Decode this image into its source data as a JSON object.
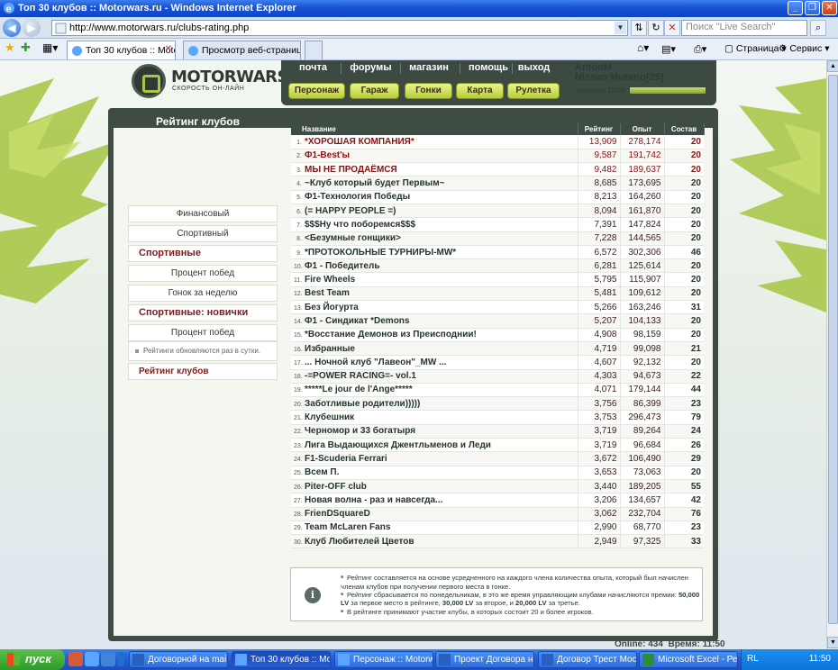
{
  "window": {
    "title": "Топ 30 клубов :: Motorwars.ru - Windows Internet Explorer"
  },
  "address_bar": {
    "url": "http://www.motorwars.ru/clubs-rating.php",
    "search_placeholder": "Поиск \"Live Search\""
  },
  "tabs": [
    {
      "label": "Топ 30 клубов :: Motorw..."
    },
    {
      "label": "Просмотр веб-страниц с ис..."
    }
  ],
  "command_bar": {
    "page_label": "Страница",
    "tools_label": "Сервис"
  },
  "site": {
    "logo_text": "MOTORWARS.RU",
    "logo_sub": "СКОРОСТЬ ОН-ЛАЙН",
    "top_nav": [
      "почта",
      "форумы",
      "магазин",
      "помощь",
      "выход"
    ],
    "green_buttons": [
      "Персонаж",
      "Гараж",
      "Гонки",
      "Карта",
      "Рулетка"
    ],
    "user": {
      "name": "AntonM",
      "car": "Nissan Murano[25]",
      "fuel_label": "заправка 100%",
      "fuel_fraction": 1.0
    }
  },
  "left_menu": {
    "title": "Рейтинг клубов",
    "items": [
      {
        "label": "Финансовый",
        "kind": "item"
      },
      {
        "label": "Спортивный",
        "kind": "item"
      },
      {
        "label": "Спортивные",
        "kind": "head"
      },
      {
        "label": "Процент побед",
        "kind": "item"
      },
      {
        "label": "Гонок за неделю",
        "kind": "item"
      },
      {
        "label": "Спортивные: новички",
        "kind": "head"
      },
      {
        "label": "Процент побед",
        "kind": "item"
      },
      {
        "label": "Гонок за неделю",
        "kind": "item"
      },
      {
        "label": "Рейтинг клубов",
        "kind": "active"
      }
    ],
    "note": "Рейтинги обновляются раз в сутки."
  },
  "table": {
    "headers": {
      "name": "Название",
      "rating": "Рейтинг",
      "exp": "Опыт",
      "size": "Состав"
    },
    "rows": [
      {
        "n": "1.",
        "name": "*ХОРОШАЯ КОМПАНИЯ*",
        "rating": "13,909",
        "exp": "278,174",
        "size": "20"
      },
      {
        "n": "2.",
        "name": "Ф1-Best'ы",
        "rating": "9,587",
        "exp": "191,742",
        "size": "20"
      },
      {
        "n": "3.",
        "name": "МЫ НЕ ПРОДАЁМСЯ",
        "rating": "9,482",
        "exp": "189,637",
        "size": "20"
      },
      {
        "n": "4.",
        "name": "~Клуб который будет Первым~",
        "rating": "8,685",
        "exp": "173,695",
        "size": "20"
      },
      {
        "n": "5.",
        "name": "Ф1-Технология Победы",
        "rating": "8,213",
        "exp": "164,260",
        "size": "20"
      },
      {
        "n": "6.",
        "name": "(= HAPPY PEOPLE =)",
        "rating": "8,094",
        "exp": "161,870",
        "size": "20"
      },
      {
        "n": "7.",
        "name": "$$$Ну что поборемся$$$",
        "rating": "7,391",
        "exp": "147,824",
        "size": "20"
      },
      {
        "n": "8.",
        "name": "<Безумные гонщики>",
        "rating": "7,228",
        "exp": "144,565",
        "size": "20"
      },
      {
        "n": "9.",
        "name": "*ПРОТОКОЛЬНЫЕ ТУРНИРЫ-MW*",
        "rating": "6,572",
        "exp": "302,306",
        "size": "46"
      },
      {
        "n": "10.",
        "name": "Ф1 - Победитель",
        "rating": "6,281",
        "exp": "125,614",
        "size": "20"
      },
      {
        "n": "11.",
        "name": "Fire Wheels",
        "rating": "5,795",
        "exp": "115,907",
        "size": "20"
      },
      {
        "n": "12.",
        "name": "Best Team",
        "rating": "5,481",
        "exp": "109,612",
        "size": "20"
      },
      {
        "n": "13.",
        "name": "Без Йогурта",
        "rating": "5,266",
        "exp": "163,246",
        "size": "31"
      },
      {
        "n": "14.",
        "name": "Ф1 - Синдикат *Demons",
        "rating": "5,207",
        "exp": "104,133",
        "size": "20"
      },
      {
        "n": "15.",
        "name": "*Восстание Демонов из Преисподнии!",
        "rating": "4,908",
        "exp": "98,159",
        "size": "20"
      },
      {
        "n": "16.",
        "name": "Избранные",
        "rating": "4,719",
        "exp": "99,098",
        "size": "21"
      },
      {
        "n": "17.",
        "name": "... Ночной клуб \"Лавеон\"_MW ...",
        "rating": "4,607",
        "exp": "92,132",
        "size": "20"
      },
      {
        "n": "18.",
        "name": "-=POWER RACING=- vol.1",
        "rating": "4,303",
        "exp": "94,673",
        "size": "22"
      },
      {
        "n": "19.",
        "name": "*****Le jour de l'Ange*****",
        "rating": "4,071",
        "exp": "179,144",
        "size": "44"
      },
      {
        "n": "20.",
        "name": "Заботливые родители)))))",
        "rating": "3,756",
        "exp": "86,399",
        "size": "23"
      },
      {
        "n": "21.",
        "name": "Клубешник",
        "rating": "3,753",
        "exp": "296,473",
        "size": "79"
      },
      {
        "n": "22.",
        "name": "Черномор и 33 богатыря",
        "rating": "3,719",
        "exp": "89,264",
        "size": "24"
      },
      {
        "n": "23.",
        "name": "Лига Выдающихся Джентльменов и Леди",
        "rating": "3,719",
        "exp": "96,684",
        "size": "26"
      },
      {
        "n": "24.",
        "name": "F1-Scuderia Ferrari",
        "rating": "3,672",
        "exp": "106,490",
        "size": "29"
      },
      {
        "n": "25.",
        "name": "Всем П.",
        "rating": "3,653",
        "exp": "73,063",
        "size": "20"
      },
      {
        "n": "26.",
        "name": "Piter-OFF club",
        "rating": "3,440",
        "exp": "189,205",
        "size": "55"
      },
      {
        "n": "27.",
        "name": "Новая волна - раз и навсегда...",
        "rating": "3,206",
        "exp": "134,657",
        "size": "42"
      },
      {
        "n": "28.",
        "name": "FrienDSquareD",
        "rating": "3,062",
        "exp": "232,704",
        "size": "76"
      },
      {
        "n": "29.",
        "name": "Team McLaren Fans",
        "rating": "2,990",
        "exp": "68,770",
        "size": "23"
      },
      {
        "n": "30.",
        "name": "Клуб Любителей Цветов",
        "rating": "2,949",
        "exp": "97,325",
        "size": "33"
      }
    ]
  },
  "info": {
    "lines": [
      "Рейтинг составляется на основе усредненного на каждого члена количества опыта, который был начислен членам клубов при получении первого места в гонке.",
      "Рейтинг сбрасывается по понедельникам, в это же время управляющим клубами начисляются премии:",
      "В рейтинге принимают участие клубы, в которых состоит 20 и более игроков."
    ],
    "prize_line": {
      "p1": "50,000 LV",
      "t1": " за первое место в рейтинге, ",
      "p2": "30,000 LV",
      "t2": " за второе, и ",
      "p3": "20,000 LV",
      "t3": " за третье."
    }
  },
  "status": {
    "online": "Online: 434",
    "time": "Время: 11:50"
  },
  "taskbar": {
    "start": "пуск",
    "buttons": [
      "Договорной на mai...",
      "Топ 30 клубов :: Мо...",
      "Персонаж :: Motorw...",
      "Проект Договора на...",
      "Договор Трест Мос...",
      "Microsoft Excel - Рее..."
    ],
    "lang": "RL",
    "clock": "11:50"
  },
  "colors": {
    "frame_dark": "#3e4c44",
    "accent_green": "#b7cd35",
    "top_red": "#8a1010"
  }
}
